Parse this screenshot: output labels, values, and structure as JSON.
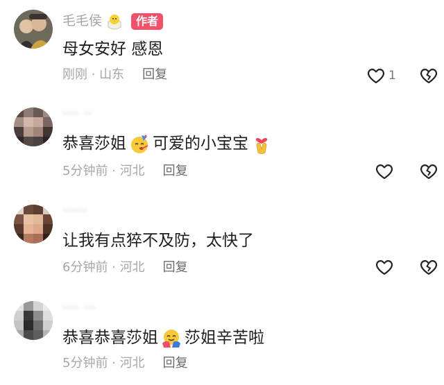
{
  "comments": [
    {
      "username": "毛毛侯",
      "author_badge": "作者",
      "text": "母女安好 感恩",
      "time": "刚刚",
      "location": "山东",
      "reply_label": "回复",
      "like_count": "1"
    },
    {
      "username": "···· ··",
      "text_before": "恭喜莎姐",
      "text_after": "可爱的小宝宝",
      "time": "5分钟前",
      "location": "河北",
      "reply_label": "回复",
      "like_count": ""
    },
    {
      "username": "······",
      "text": "让我有点猝不及防，太快了",
      "time": "6分钟前",
      "location": "河北",
      "reply_label": "回复",
      "like_count": ""
    },
    {
      "username": "···· ···",
      "text_before": "恭喜恭喜莎姐",
      "text_after": "莎姐辛苦啦",
      "time": "5分钟前",
      "location": "河北",
      "reply_label": "回复",
      "like_count": ""
    }
  ],
  "separator": " · ",
  "icons": {
    "like": "heart-outline-icon",
    "dislike": "broken-heart-icon",
    "author_emoji": "hatching-chick-icon",
    "emoji_party": "party-face-icon",
    "emoji_heart_hands": "heart-hands-icon",
    "emoji_hug": "hugging-face-icon"
  },
  "colors": {
    "badge_bg": "#f2516b",
    "meta_text": "#a7a7a7",
    "reply_text": "#6b6b6b",
    "content_text": "#1e1e1e",
    "icon_stroke": "#222222"
  }
}
